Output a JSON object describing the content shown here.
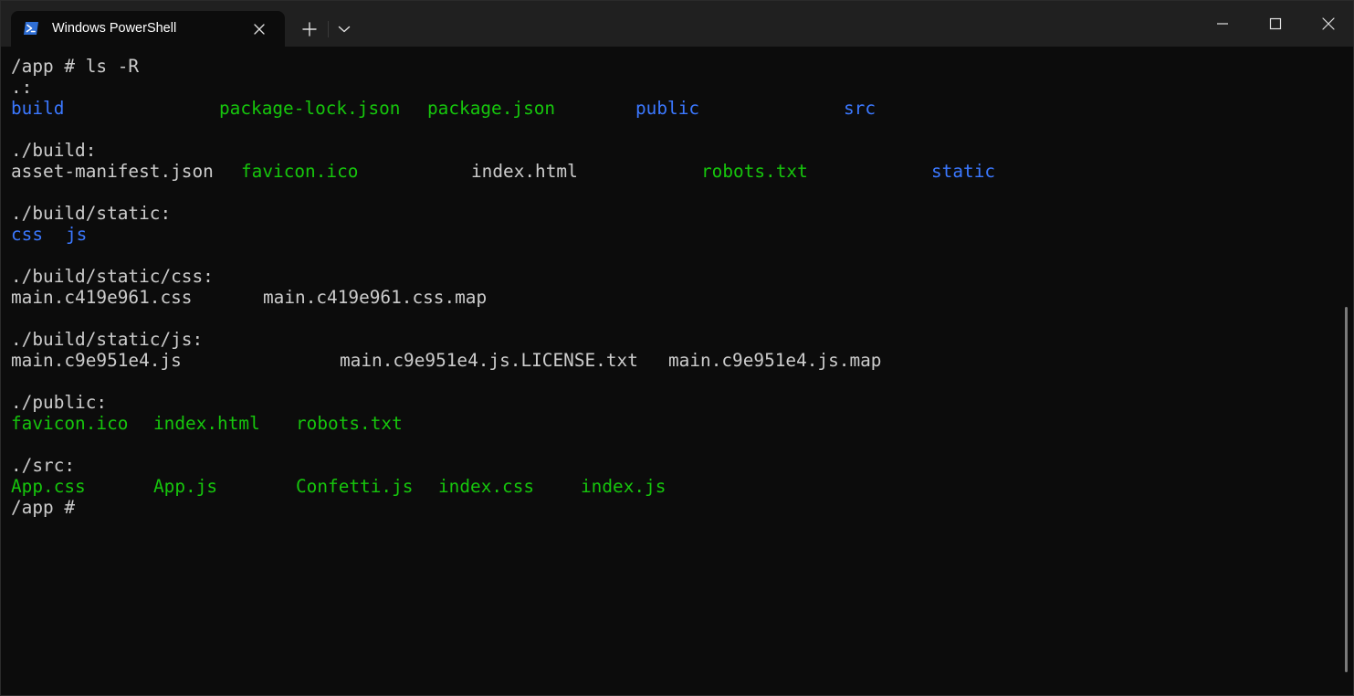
{
  "tab": {
    "title": "Windows PowerShell",
    "icon": "powershell-icon"
  },
  "titlebar": {
    "new_tab_icon": "plus-icon",
    "dropdown_icon": "chevron-down-icon",
    "minimize_icon": "minimize-icon",
    "maximize_icon": "maximize-icon",
    "close_icon": "close-icon"
  },
  "colors": {
    "directory": "#3b78ff",
    "executable": "#16c60c",
    "text": "#cccccc",
    "background": "#0c0c0c"
  },
  "terminal": {
    "command_line": "/app # ls -R",
    "root_header": ".:",
    "root_items": [
      "build",
      "package-lock.json",
      "package.json",
      "public",
      "src"
    ],
    "build_header": "./build:",
    "build_items": [
      "asset-manifest.json",
      "favicon.ico",
      "index.html",
      "robots.txt",
      "static"
    ],
    "static_header": "./build/static:",
    "static_items": [
      "css",
      "js"
    ],
    "css_header": "./build/static/css:",
    "css_items": [
      "main.c419e961.css",
      "main.c419e961.css.map"
    ],
    "js_header": "./build/static/js:",
    "js_items": [
      "main.c9e951e4.js",
      "main.c9e951e4.js.LICENSE.txt",
      "main.c9e951e4.js.map"
    ],
    "public_header": "./public:",
    "public_items": [
      "favicon.ico",
      "index.html",
      "robots.txt"
    ],
    "src_header": "./src:",
    "src_items": [
      "App.css",
      "App.js",
      "Confetti.js",
      "index.css",
      "index.js"
    ],
    "prompt": "/app #"
  }
}
